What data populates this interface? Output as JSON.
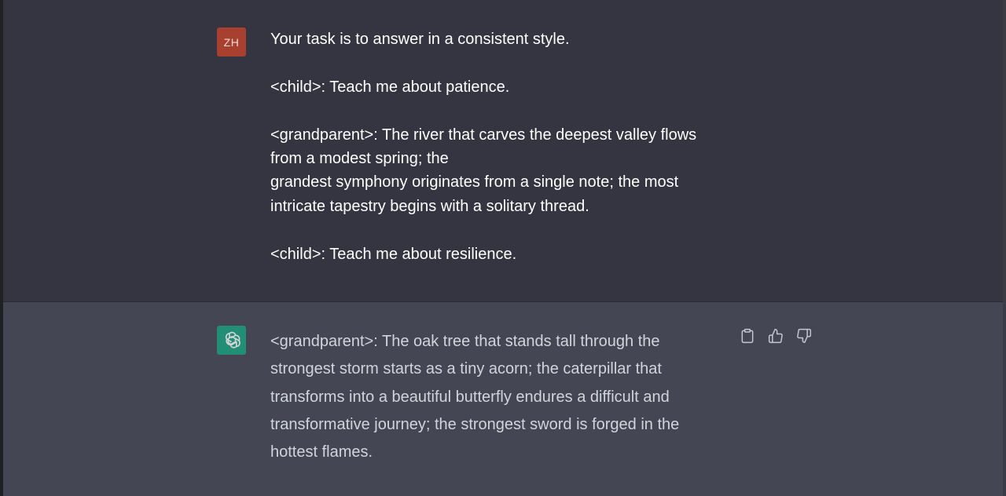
{
  "user_turn": {
    "avatar_initials": "ZH",
    "paragraphs": [
      "Your task is to answer in a consistent style.",
      "<child>: Teach me about patience.",
      "<grandparent>: The river that carves the deepest valley flows from a modest spring; the\ngrandest symphony originates from a single note; the most intricate tapestry begins with a solitary thread.",
      "<child>: Teach me about resilience."
    ]
  },
  "assistant_turn": {
    "avatar_icon": "openai-logo-icon",
    "text": "<grandparent>: The oak tree that stands tall through the strongest storm starts as a tiny acorn; the caterpillar that transforms into a beautiful butterfly endures a difficult and transformative journey; the strongest sword is forged in the hottest flames.",
    "actions": [
      {
        "name": "copy-icon"
      },
      {
        "name": "thumbs-up-icon"
      },
      {
        "name": "thumbs-down-icon"
      }
    ]
  },
  "colors": {
    "user_bg": "#343541",
    "assistant_bg": "#444654",
    "user_avatar": "#a8402f",
    "assistant_avatar": "#19a37f"
  }
}
